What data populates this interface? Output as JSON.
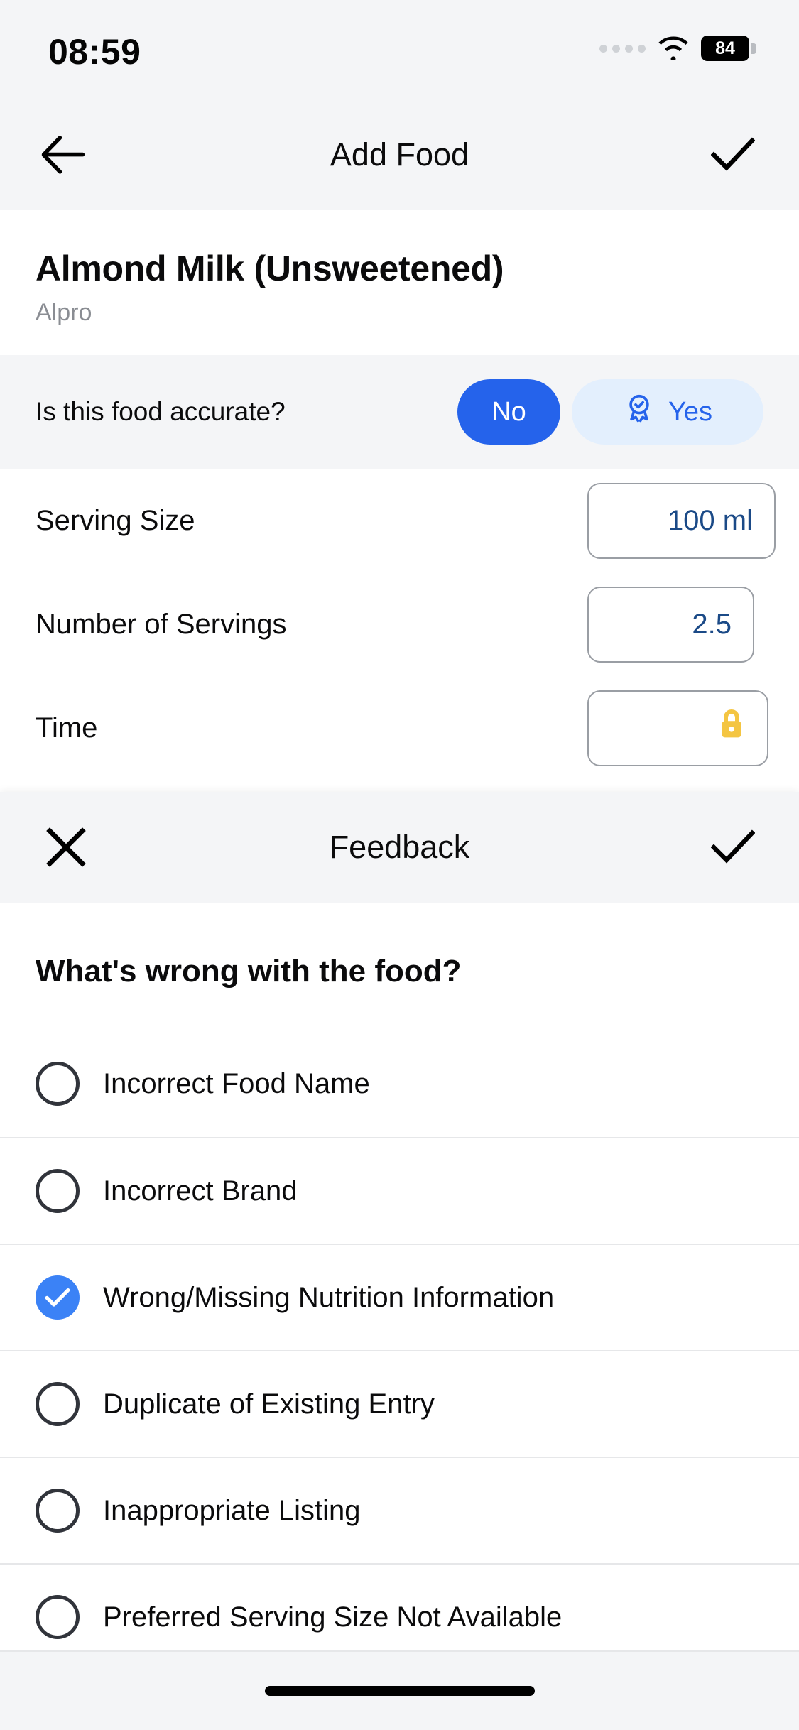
{
  "status_bar": {
    "time": "08:59",
    "battery_percent": "84",
    "wifi_icon": "wifi-icon",
    "signal_icon": "signal-dots-icon"
  },
  "nav": {
    "title": "Add Food",
    "back_icon": "back-arrow-icon",
    "confirm_icon": "checkmark-icon"
  },
  "food": {
    "name": "Almond Milk (Unsweetened)",
    "brand": "Alpro"
  },
  "accuracy": {
    "question": "Is this food accurate?",
    "no_label": "No",
    "yes_label": "Yes",
    "selected": "No",
    "yes_icon": "verified-badge-icon",
    "accent_selected": "#2563eb",
    "accent_unselected_bg": "#e3effd"
  },
  "form": {
    "rows": [
      {
        "label": "Serving Size",
        "value": "100 ml"
      },
      {
        "label": "Number of Servings",
        "value": "2.5"
      },
      {
        "label": "Time",
        "value": "",
        "icon": "lock-icon",
        "icon_color": "#f4c542"
      }
    ]
  },
  "feedback_sheet": {
    "title": "Feedback",
    "close_icon": "close-x-icon",
    "confirm_icon": "checkmark-icon",
    "question": "What's wrong with the food?",
    "selected_color": "#3b82f6",
    "options": [
      {
        "label": "Incorrect Food Name",
        "selected": false
      },
      {
        "label": "Incorrect Brand",
        "selected": false
      },
      {
        "label": "Wrong/Missing Nutrition Information",
        "selected": true
      },
      {
        "label": "Duplicate of Existing Entry",
        "selected": false
      },
      {
        "label": "Inappropriate Listing",
        "selected": false
      },
      {
        "label": "Preferred Serving Size Not Available",
        "selected": false
      }
    ]
  },
  "home_indicator": {
    "label": "home-indicator"
  }
}
